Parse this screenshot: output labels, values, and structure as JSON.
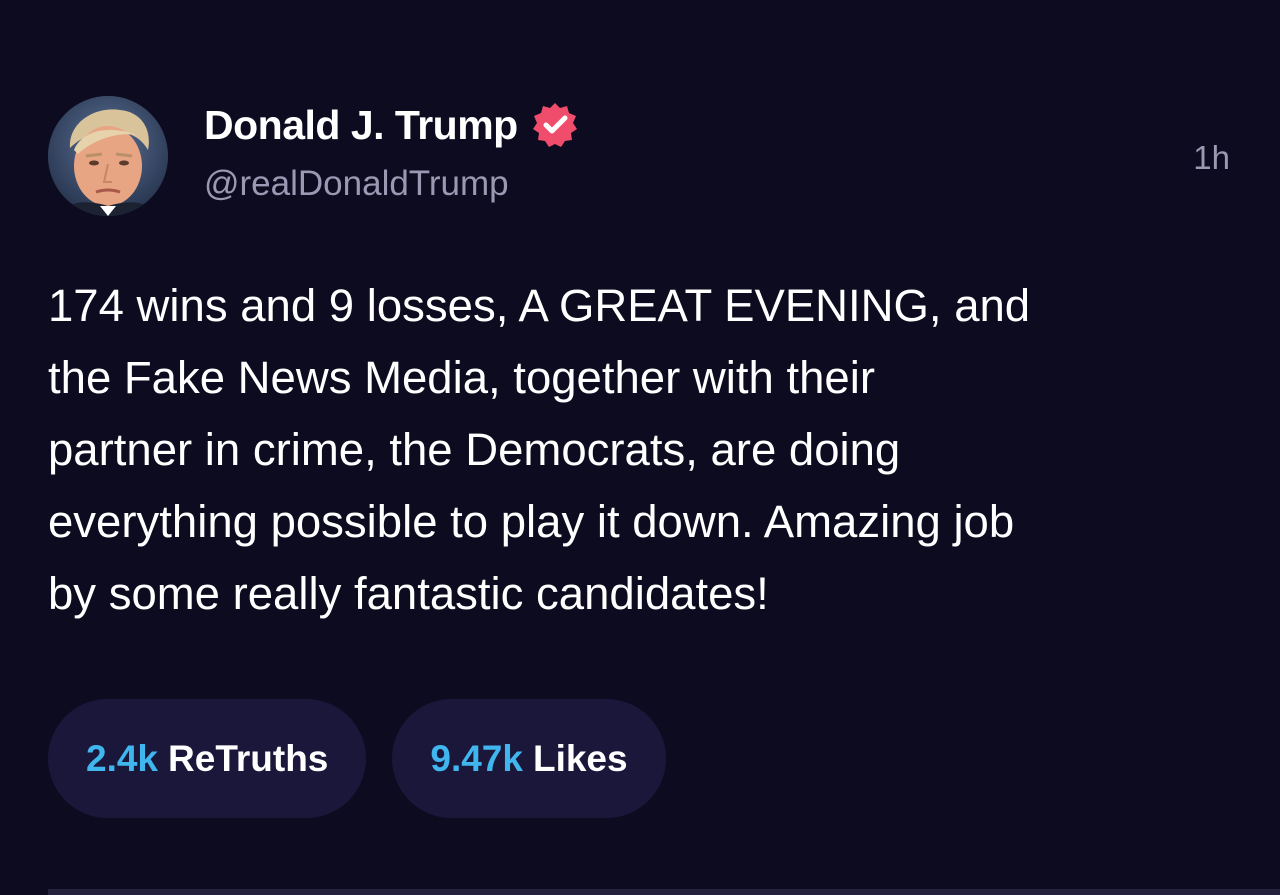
{
  "post": {
    "author": {
      "display_name": "Donald J. Trump",
      "handle": "@realDonaldTrump",
      "verified_icon": "verified-badge-icon",
      "avatar": "profile-photo"
    },
    "timestamp": "1h",
    "content": "174 wins and 9 losses, A GREAT EVENING, and\nthe Fake News Media, together with their\npartner in crime, the Democrats, are doing\neverything possible to play it down. Amazing job\nby some really fantastic candidates!",
    "stats": {
      "retruths": {
        "count": "2.4k",
        "label": "ReTruths"
      },
      "likes": {
        "count": "9.47k",
        "label": "Likes"
      }
    }
  },
  "colors": {
    "background": "#0d0b1f",
    "pill_background": "#1b173a",
    "count_accent": "#3fb6ee",
    "muted_text": "#9a98b3",
    "verified_badge": "#ef4d6b"
  }
}
